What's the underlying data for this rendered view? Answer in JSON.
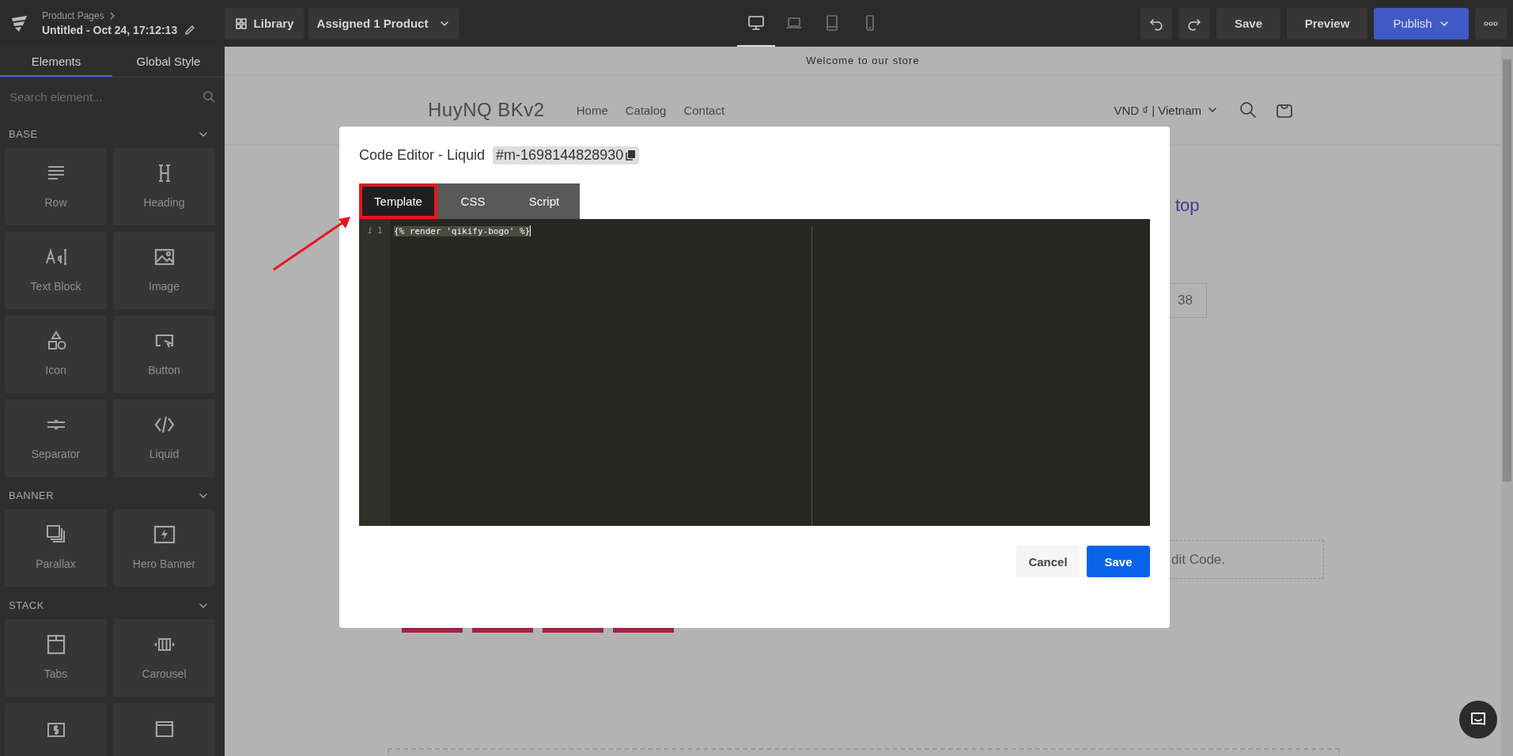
{
  "header": {
    "breadcrumb": "Product Pages",
    "page_title": "Untitled - Oct 24, 17:12:13"
  },
  "toolbar": {
    "library": "Library",
    "assigned": "Assigned 1 Product",
    "devices": [
      {
        "kind": "desktop",
        "selected": true
      },
      {
        "kind": "laptop",
        "selected": false
      },
      {
        "kind": "tablet",
        "selected": false
      },
      {
        "kind": "mobile",
        "selected": false
      }
    ],
    "save": "Save",
    "preview": "Preview",
    "publish": "Publish"
  },
  "sidebar": {
    "tabs": [
      {
        "label": "Elements",
        "selected": true
      },
      {
        "label": "Global Style",
        "selected": false
      }
    ],
    "search": {
      "placeholder": "Search element..."
    },
    "sections": [
      {
        "title": "BASE",
        "expanded": true,
        "items": [
          {
            "label": "Row",
            "kind": "row"
          },
          {
            "label": "Heading",
            "kind": "heading"
          },
          {
            "label": "Text Block",
            "kind": "text"
          },
          {
            "label": "Image",
            "kind": "image"
          },
          {
            "label": "Icon",
            "kind": "shapes"
          },
          {
            "label": "Button",
            "kind": "button"
          },
          {
            "label": "Separator",
            "kind": "separator"
          },
          {
            "label": "Liquid",
            "kind": "code"
          }
        ]
      },
      {
        "title": "BANNER",
        "expanded": true,
        "items": [
          {
            "label": "Parallax",
            "kind": "layers"
          },
          {
            "label": "Hero Banner",
            "kind": "hero"
          }
        ]
      },
      {
        "title": "STACK",
        "expanded": true,
        "items": [
          {
            "label": "Tabs",
            "kind": "tabs"
          },
          {
            "label": "Carousel",
            "kind": "carousel"
          },
          {
            "kind": "price"
          },
          {
            "kind": "panel"
          }
        ]
      }
    ]
  },
  "canvas": {
    "announcement": "Welcome to our store",
    "store_name": "HuyNQ BKv2",
    "nav": [
      "Home",
      "Catalog",
      "Contact"
    ],
    "currency": "VND ₫ | Vietnam",
    "title_fragment": "top",
    "variant_fragment": "38",
    "code_fragment": "dit Code."
  },
  "modal": {
    "title": "Code Editor - Liquid",
    "element_id": "#m-1698144828930",
    "tabs": [
      {
        "label": "Template",
        "selected": true,
        "highlighted": true
      },
      {
        "label": "CSS",
        "selected": false,
        "highlighted": false
      },
      {
        "label": "Script",
        "selected": false,
        "highlighted": false
      }
    ],
    "lines": [
      {
        "marker": "i",
        "number": "1",
        "code": "{% render 'qikify-bogo' %}",
        "selected": true
      }
    ],
    "cancel": "Cancel",
    "save": "Save"
  }
}
